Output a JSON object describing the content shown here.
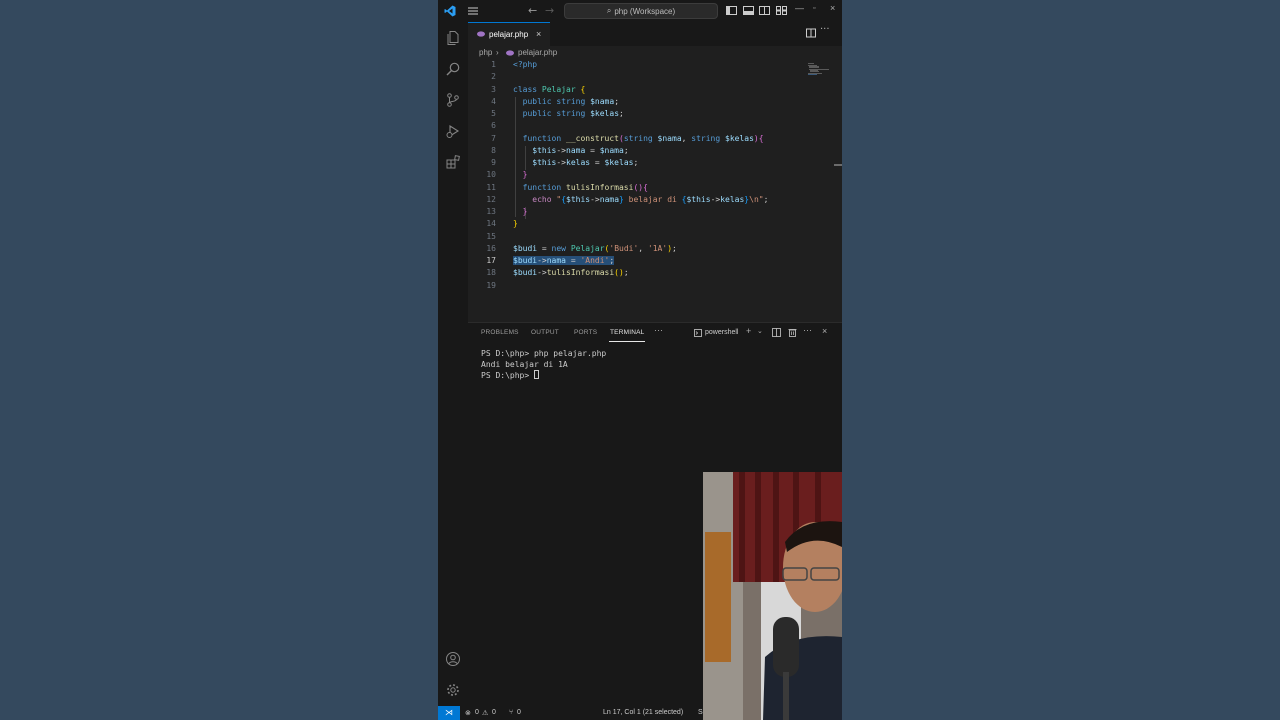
{
  "titlebar": {
    "command_center": "php (Workspace)"
  },
  "tab": {
    "filename": "pelajar.php"
  },
  "breadcrumb": {
    "folder": "php",
    "file": "pelajar.php"
  },
  "editor": {
    "lines": [
      {
        "n": "1"
      },
      {
        "n": "2"
      },
      {
        "n": "3"
      },
      {
        "n": "4"
      },
      {
        "n": "5"
      },
      {
        "n": "6"
      },
      {
        "n": "7"
      },
      {
        "n": "8"
      },
      {
        "n": "9"
      },
      {
        "n": "10"
      },
      {
        "n": "11"
      },
      {
        "n": "12"
      },
      {
        "n": "13"
      },
      {
        "n": "14"
      },
      {
        "n": "15"
      },
      {
        "n": "16"
      },
      {
        "n": "17"
      },
      {
        "n": "18"
      },
      {
        "n": "19"
      }
    ],
    "active_line": "17"
  },
  "panel": {
    "tabs": [
      "PROBLEMS",
      "OUTPUT",
      "PORTS",
      "TERMINAL"
    ],
    "active_tab": "TERMINAL",
    "shell": "powershell",
    "terminal_lines": [
      "PS D:\\php> php pelajar.php",
      "Andi belajar di 1A",
      "PS D:\\php> "
    ]
  },
  "statusbar": {
    "errors": "0",
    "warnings": "0",
    "ports": "0",
    "cursor_position": "Ln 17, Col 1 (21 selected)",
    "truncated": "S"
  },
  "colors": {
    "accent": "#0078d4",
    "background": "#34495e",
    "editor": "#1f1f1f"
  }
}
